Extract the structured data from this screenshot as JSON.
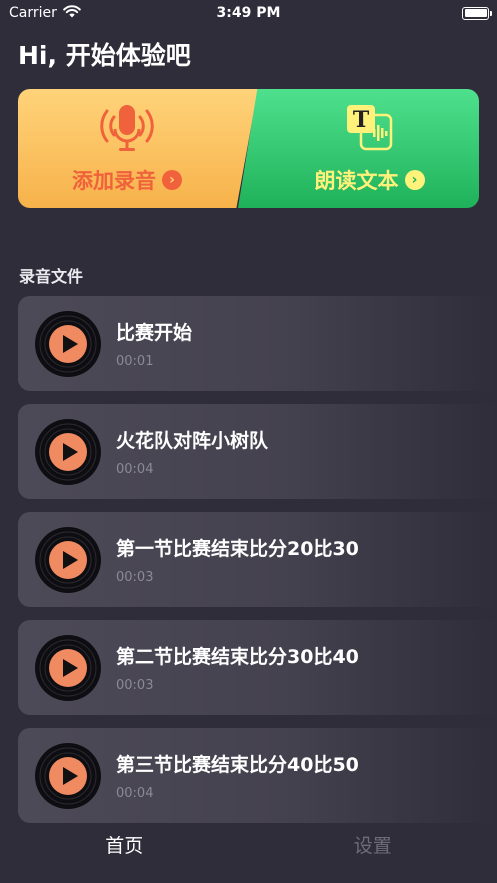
{
  "status_bar": {
    "carrier": "Carrier",
    "time": "3:49 PM"
  },
  "greeting": "Hi, 开始体验吧",
  "actions": {
    "record": {
      "label": "添加录音",
      "icon": "microphone-icon",
      "color": "#f0623c"
    },
    "read": {
      "label": "朗读文本",
      "icon": "text-to-speech-icon",
      "color": "#fff27a"
    }
  },
  "section_title": "录音文件",
  "recordings": [
    {
      "title": "比赛开始",
      "duration": "00:01"
    },
    {
      "title": "火花队对阵小树队",
      "duration": "00:04"
    },
    {
      "title": "第一节比赛结束比分20比30",
      "duration": "00:03"
    },
    {
      "title": "第二节比赛结束比分30比40",
      "duration": "00:03"
    },
    {
      "title": "第三节比赛结束比分40比50",
      "duration": "00:04"
    }
  ],
  "tabs": [
    {
      "label": "首页",
      "active": true
    },
    {
      "label": "设置",
      "active": false
    }
  ],
  "colors": {
    "background": "#2f2d3a",
    "play_button": "#f08a60",
    "record_card": "#f7b24a",
    "read_card": "#1fb25a"
  }
}
